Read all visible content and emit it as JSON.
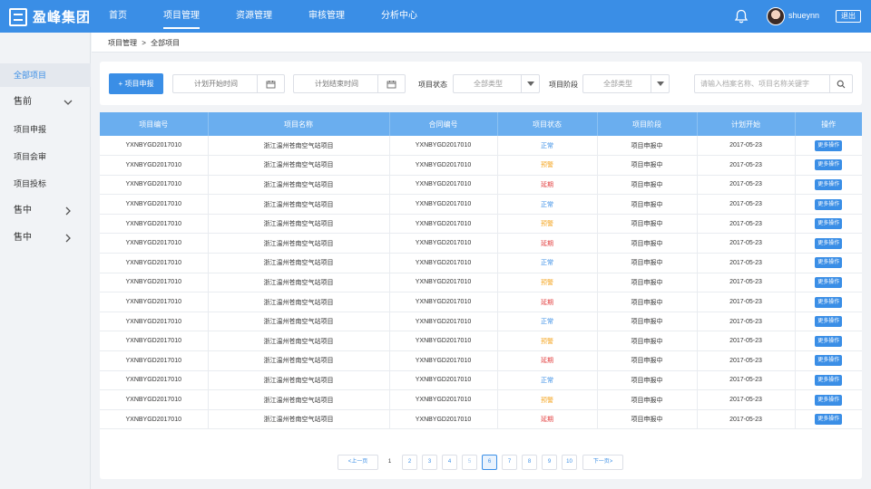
{
  "brand": {
    "name": "盈峰集团"
  },
  "nav": {
    "items": [
      {
        "label": "首页"
      },
      {
        "label": "项目管理"
      },
      {
        "label": "资源管理"
      },
      {
        "label": "审核管理"
      },
      {
        "label": "分析中心"
      }
    ],
    "active_index": 1
  },
  "user": {
    "name": "shueynn",
    "logout": "退出"
  },
  "sidebar": {
    "items": [
      {
        "label": "全部项目",
        "active": true
      },
      {
        "label": "售前",
        "expandable": "open"
      },
      {
        "label": "项目申报"
      },
      {
        "label": "项目会审"
      },
      {
        "label": "项目投标"
      },
      {
        "label": "售中",
        "expandable": "closed"
      },
      {
        "label": "售中",
        "expandable": "closed"
      }
    ]
  },
  "breadcrumb": {
    "items": [
      "项目管理",
      "全部项目"
    ],
    "separator": ">"
  },
  "filter": {
    "new_button": "+ 项目申报",
    "start_placeholder": "计划开始时间",
    "end_placeholder": "计划结束时间",
    "status_label": "项目状态",
    "status_value": "全部类型",
    "stage_label": "项目阶段",
    "stage_value": "全部类型",
    "search_placeholder": "请输入档案名称、项目名称关键字"
  },
  "table": {
    "headers": [
      "项目编号",
      "项目名称",
      "合同编号",
      "项目状态",
      "项目阶段",
      "计划开始",
      "操作"
    ],
    "rows": [
      [
        "YXNBYGD2017010",
        "浙江温州苍南空气站项目",
        "YXNBYGD2017010",
        "正常",
        "项目申报中",
        "2017-05-23",
        "更多操作"
      ],
      [
        "YXNBYGD2017010",
        "浙江温州苍南空气站项目",
        "YXNBYGD2017010",
        "预警",
        "项目申报中",
        "2017-05-23",
        "更多操作"
      ],
      [
        "YXNBYGD2017010",
        "浙江温州苍南空气站项目",
        "YXNBYGD2017010",
        "延期",
        "项目申报中",
        "2017-05-23",
        "更多操作"
      ],
      [
        "YXNBYGD2017010",
        "浙江温州苍南空气站项目",
        "YXNBYGD2017010",
        "正常",
        "项目申报中",
        "2017-05-23",
        "更多操作"
      ],
      [
        "YXNBYGD2017010",
        "浙江温州苍南空气站项目",
        "YXNBYGD2017010",
        "预警",
        "项目申报中",
        "2017-05-23",
        "更多操作"
      ],
      [
        "YXNBYGD2017010",
        "浙江温州苍南空气站项目",
        "YXNBYGD2017010",
        "延期",
        "项目申报中",
        "2017-05-23",
        "更多操作"
      ],
      [
        "YXNBYGD2017010",
        "浙江温州苍南空气站项目",
        "YXNBYGD2017010",
        "正常",
        "项目申报中",
        "2017-05-23",
        "更多操作"
      ],
      [
        "YXNBYGD2017010",
        "浙江温州苍南空气站项目",
        "YXNBYGD2017010",
        "预警",
        "项目申报中",
        "2017-05-23",
        "更多操作"
      ],
      [
        "YXNBYGD2017010",
        "浙江温州苍南空气站项目",
        "YXNBYGD2017010",
        "延期",
        "项目申报中",
        "2017-05-23",
        "更多操作"
      ],
      [
        "YXNBYGD2017010",
        "浙江温州苍南空气站项目",
        "YXNBYGD2017010",
        "正常",
        "项目申报中",
        "2017-05-23",
        "更多操作"
      ],
      [
        "YXNBYGD2017010",
        "浙江温州苍南空气站项目",
        "YXNBYGD2017010",
        "预警",
        "项目申报中",
        "2017-05-23",
        "更多操作"
      ],
      [
        "YXNBYGD2017010",
        "浙江温州苍南空气站项目",
        "YXNBYGD2017010",
        "延期",
        "项目申报中",
        "2017-05-23",
        "更多操作"
      ],
      [
        "YXNBYGD2017010",
        "浙江温州苍南空气站项目",
        "YXNBYGD2017010",
        "正常",
        "项目申报中",
        "2017-05-23",
        "更多操作"
      ],
      [
        "YXNBYGD2017010",
        "浙江温州苍南空气站项目",
        "YXNBYGD2017010",
        "预警",
        "项目申报中",
        "2017-05-23",
        "更多操作"
      ],
      [
        "YXNBYGD2017010",
        "浙江温州苍南空气站项目",
        "YXNBYGD2017010",
        "延期",
        "项目申报中",
        "2017-05-23",
        "更多操作"
      ]
    ]
  },
  "status_colors": {
    "正常": "#3a8ee6",
    "预警": "#f5a623",
    "延期": "#e23c3c"
  },
  "pagination": {
    "prev": "<上一页",
    "next": "下一页>",
    "pages": [
      "1",
      "2",
      "3",
      "4",
      "5",
      "6",
      "7",
      "8",
      "9",
      "10"
    ],
    "current": "6"
  },
  "icons": {
    "bell": "bell-icon",
    "calendar": "calendar-icon",
    "caret": "caret-down-icon",
    "search": "search-icon"
  },
  "colors": {
    "primary": "#3a8ee6",
    "table_header": "#6aaeef"
  }
}
